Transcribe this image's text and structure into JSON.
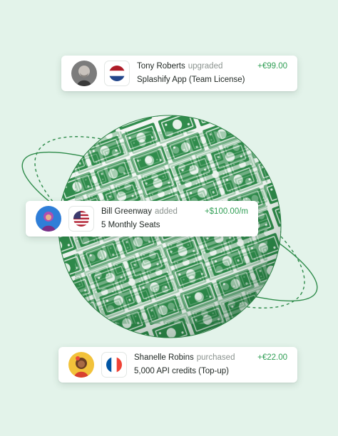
{
  "colors": {
    "background": "#e3f3ea",
    "globe_green": "#2e8b4a",
    "amount_green": "#2f9e54"
  },
  "notifications": [
    {
      "name": "Tony Roberts",
      "action": "upgraded",
      "item": "Splashify App (Team License)",
      "amount": "+€99.00",
      "flag": "netherlands-flag",
      "avatar": "tony-roberts-avatar"
    },
    {
      "name": "Bill Greenway",
      "action": "added",
      "item": "5 Monthly Seats",
      "amount": "+$100.00/m",
      "flag": "usa-flag",
      "avatar": "bill-greenway-avatar"
    },
    {
      "name": "Shanelle Robins",
      "action": "purchased",
      "item": "5,000 API credits (Top-up)",
      "amount": "+€22.00",
      "flag": "france-flag",
      "avatar": "shanelle-robins-avatar"
    }
  ]
}
